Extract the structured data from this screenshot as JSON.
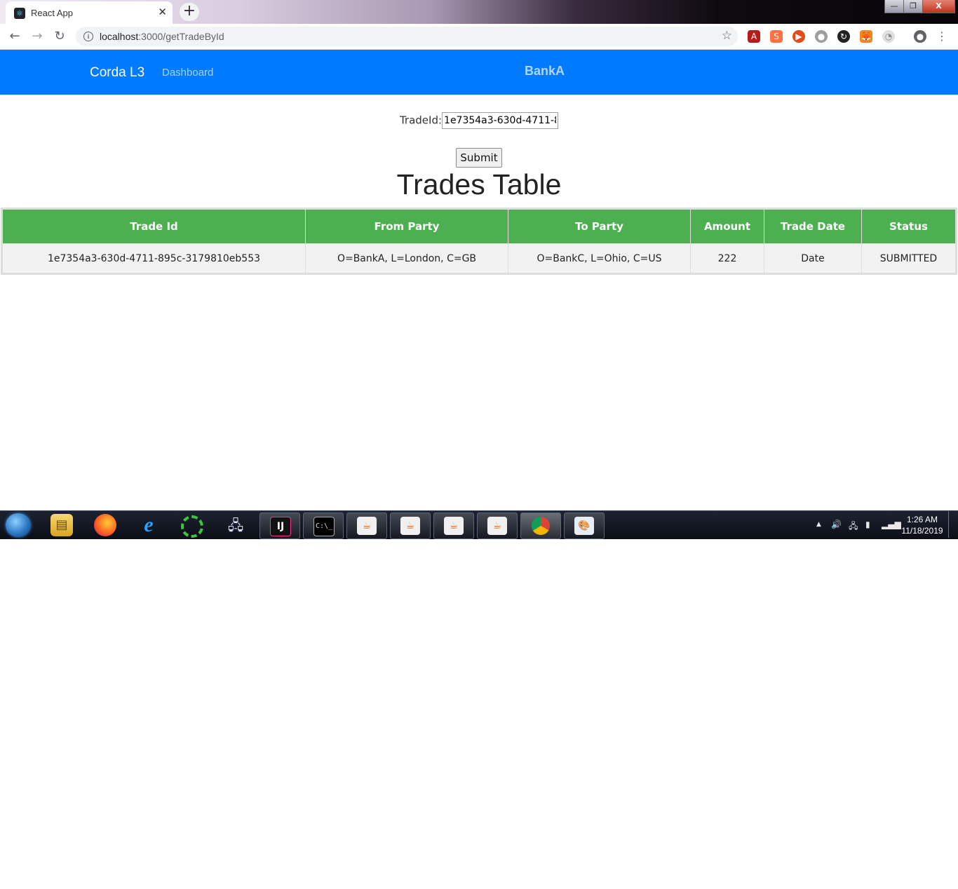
{
  "browser": {
    "tab_title": "React App",
    "tab_close": "✕",
    "new_tab": "+",
    "url_host": "localhost",
    "url_path": ":3000/getTradeById",
    "window_controls": {
      "minimize": "—",
      "maximize": "❐",
      "close": "X"
    }
  },
  "navbar": {
    "brand": "Corda L3",
    "links": [
      "Dashboard"
    ],
    "bank": "BankA"
  },
  "form": {
    "label": "TradeId:",
    "trade_id_value": "1e7354a3-630d-4711-8",
    "submit_label": "Submit"
  },
  "table": {
    "heading": "Trades Table",
    "columns": [
      "Trade Id",
      "From Party",
      "To Party",
      "Amount",
      "Trade Date",
      "Status"
    ],
    "rows": [
      [
        "1e7354a3-630d-4711-895c-3179810eb553",
        "O=BankA, L=London, C=GB",
        "O=BankC, L=Ohio, C=US",
        "222",
        "Date",
        "SUBMITTED"
      ]
    ]
  },
  "taskbar": {
    "time": "1:26 AM",
    "date": "11/18/2019"
  },
  "colors": {
    "navbar": "#007bff",
    "table_header": "#4caf50",
    "table_row": "#f2f2f2"
  }
}
